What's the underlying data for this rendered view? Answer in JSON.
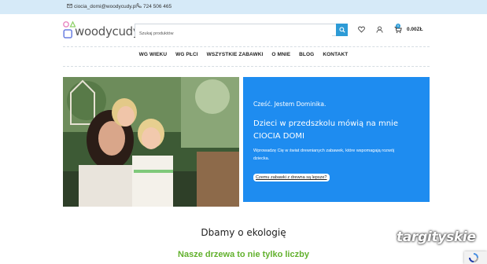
{
  "topbar": {
    "email": "ciocia_domi@woodycudy.pl",
    "phone": "724 506 465"
  },
  "logo": {
    "text": "woodycudy"
  },
  "search": {
    "placeholder": "Szukaj produktów"
  },
  "cart": {
    "amount": "0.00ZŁ",
    "count": "0"
  },
  "nav": {
    "items": [
      "WG WIEKU",
      "WG PŁCI",
      "WSZYSTKIE ZABAWKI",
      "O MNIE",
      "BLOG",
      "KONTAKT"
    ]
  },
  "hero": {
    "greeting": "Cześć. Jestem Dominika.",
    "headline": "Dzieci w przedszkolu mówią na mnie CIOCIA DOMI",
    "description": "Wprowadzę Cię w świat drewnianych zabawek, które wspomagają rozwój dziecka.",
    "cta": "Czemu zabawki z drewna są lepsze?"
  },
  "sections": {
    "eco_title": "Dbamy o ekologię",
    "green_title": "Nasze drzewa to nie tylko liczby"
  },
  "watermark": "targityskie",
  "colors": {
    "topbar_bg": "#d6eaf8",
    "accent_blue": "#1e8cf0",
    "search_btn": "#2d9bd6",
    "green": "#62b12d"
  },
  "icons": {
    "email": "email-icon",
    "phone": "phone-icon",
    "search": "search-icon",
    "wishlist": "heart-icon",
    "account": "user-icon",
    "cart": "cart-icon"
  }
}
